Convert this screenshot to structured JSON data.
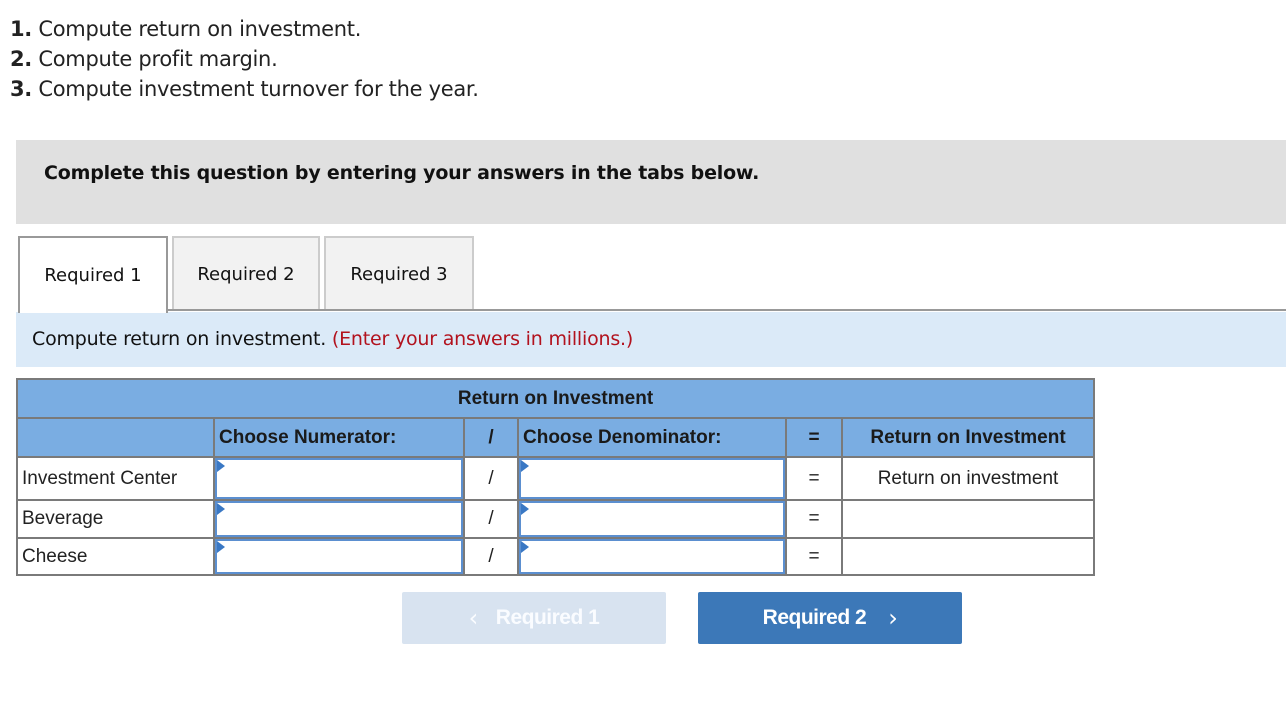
{
  "instructions": [
    {
      "num": "1.",
      "text": " Compute return on investment."
    },
    {
      "num": "2.",
      "text": " Compute profit margin."
    },
    {
      "num": "3.",
      "text": " Compute investment turnover for the year."
    }
  ],
  "banner": {
    "text": "Complete this question by entering your answers in the tabs below."
  },
  "tabs": [
    {
      "label": "Required 1",
      "active": true
    },
    {
      "label": "Required 2",
      "active": false
    },
    {
      "label": "Required 3",
      "active": false
    }
  ],
  "prompt": {
    "text": "Compute return on investment.",
    "note": "(Enter your answers in millions.)"
  },
  "table": {
    "title": "Return on Investment",
    "columns": {
      "numerator": "Choose Numerator:",
      "divide": "/",
      "denominator": "Choose Denominator:",
      "equals": "=",
      "result": "Return on Investment"
    },
    "rows": [
      {
        "label": "Investment Center",
        "numerator": "",
        "op": "/",
        "denominator": "",
        "eq": "=",
        "result": "Return on investment"
      },
      {
        "label": "Beverage",
        "numerator": "",
        "op": "/",
        "denominator": "",
        "eq": "=",
        "result": ""
      },
      {
        "label": "Cheese",
        "numerator": "",
        "op": "/",
        "denominator": "",
        "eq": "=",
        "result": ""
      }
    ]
  },
  "nav": {
    "prev": {
      "label": "Required 1",
      "icon": "chevron-left-icon",
      "glyph": "‹",
      "enabled": false
    },
    "next": {
      "label": "Required 2",
      "icon": "chevron-right-icon",
      "glyph": "›",
      "enabled": true
    }
  },
  "colors": {
    "header_blue": "#7aade2",
    "prompt_bg": "#dbeaf8",
    "note_red": "#b2121e",
    "next_button": "#3c78b8",
    "prev_button_disabled": "#d8e3f0",
    "banner_gray": "#e0e0e0"
  }
}
